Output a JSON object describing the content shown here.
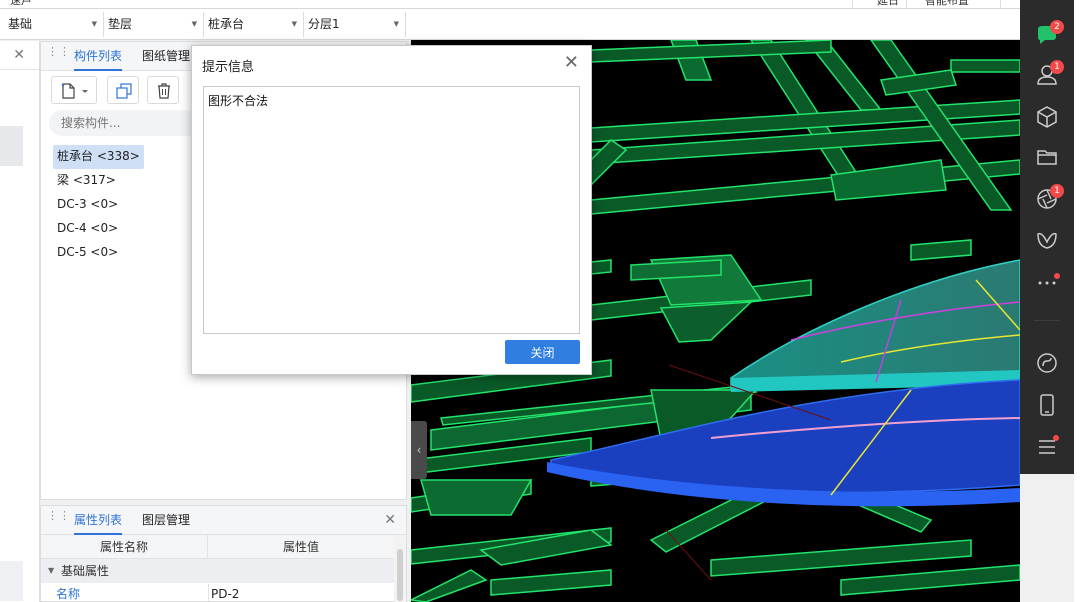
{
  "top_strip": {
    "left_text": "速戶",
    "mid_text": "延日",
    "right_text": "智能布置"
  },
  "selectors": [
    {
      "label": "基础"
    },
    {
      "label": "垫层"
    },
    {
      "label": "桩承台"
    },
    {
      "label": "分层1"
    }
  ],
  "component_panel": {
    "tabs": [
      "构件列表",
      "图纸管理"
    ],
    "search_placeholder": "搜索构件...",
    "items": [
      "桩承台 <338>",
      "梁 <317>",
      "DC-3 <0>",
      "DC-4 <0>",
      "DC-5 <0>"
    ]
  },
  "property_panel": {
    "tabs": [
      "属性列表",
      "图层管理"
    ],
    "columns": [
      "属性名称",
      "属性值"
    ],
    "group": "基础属性",
    "rows": [
      {
        "name": "名称",
        "value": "PD-2"
      }
    ]
  },
  "dialog": {
    "title": "提示信息",
    "message": "图形不合法",
    "button": "关闭"
  },
  "right_bar": {
    "badges": {
      "chat": "2",
      "contacts": "1",
      "shutter": "1"
    }
  },
  "colors": {
    "accent": "#2f73d6",
    "button": "#2f7ee0",
    "viewport_bg": "#000000",
    "model_edge": "#22e36b",
    "badge": "#f24a4a"
  }
}
